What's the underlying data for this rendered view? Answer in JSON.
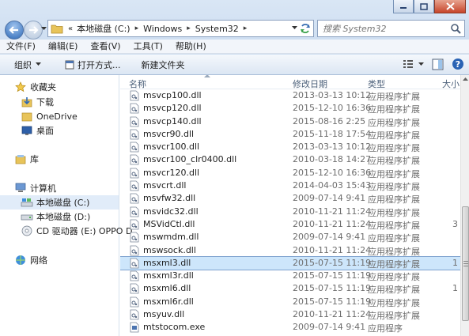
{
  "window": {
    "minimize_label": "",
    "colors": {
      "accent": "#2d69b6",
      "selection": "#cde6fb",
      "close": "#c7452b"
    }
  },
  "address": {
    "lead": "«",
    "crumbs": [
      "本地磁盘 (C:)",
      "Windows",
      "System32"
    ]
  },
  "search": {
    "placeholder": "搜索 System32"
  },
  "menubar": [
    "文件(F)",
    "编辑(E)",
    "查看(V)",
    "工具(T)",
    "帮助(H)"
  ],
  "toolbar": {
    "organize": "组织",
    "open_with": "打开方式...",
    "new_folder": "新建文件夹"
  },
  "nav": {
    "favorites": "收藏夹",
    "downloads": "下载",
    "onedrive": "OneDrive",
    "desktop": "桌面",
    "libraries": "库",
    "computer": "计算机",
    "drive_c": "本地磁盘 (C:)",
    "drive_d": "本地磁盘 (D:)",
    "cd_drive": "CD 驱动器 (E:) OPPO D",
    "network": "网络"
  },
  "columns": {
    "name": "名称",
    "date": "修改日期",
    "type": "类型",
    "size": "大小"
  },
  "files": [
    {
      "name": "msvcp100.dll",
      "date": "2013-03-13 10:12",
      "type": "应用程序扩展",
      "size": ""
    },
    {
      "name": "msvcp120.dll",
      "date": "2015-12-10 16:36",
      "type": "应用程序扩展",
      "size": ""
    },
    {
      "name": "msvcp140.dll",
      "date": "2015-08-16 2:25",
      "type": "应用程序扩展",
      "size": ""
    },
    {
      "name": "msvcr90.dll",
      "date": "2015-11-18 17:54",
      "type": "应用程序扩展",
      "size": ""
    },
    {
      "name": "msvcr100.dll",
      "date": "2013-03-13 10:12",
      "type": "应用程序扩展",
      "size": ""
    },
    {
      "name": "msvcr100_clr0400.dll",
      "date": "2010-03-18 14:27",
      "type": "应用程序扩展",
      "size": ""
    },
    {
      "name": "msvcr120.dll",
      "date": "2015-12-10 16:36",
      "type": "应用程序扩展",
      "size": ""
    },
    {
      "name": "msvcrt.dll",
      "date": "2014-04-03 15:43",
      "type": "应用程序扩展",
      "size": ""
    },
    {
      "name": "msvfw32.dll",
      "date": "2009-07-14 9:41",
      "type": "应用程序扩展",
      "size": ""
    },
    {
      "name": "msvidc32.dll",
      "date": "2010-11-21 11:24",
      "type": "应用程序扩展",
      "size": ""
    },
    {
      "name": "MSVidCtl.dll",
      "date": "2010-11-21 11:24",
      "type": "应用程序扩展",
      "size": "3"
    },
    {
      "name": "mswmdm.dll",
      "date": "2009-07-14 9:41",
      "type": "应用程序扩展",
      "size": ""
    },
    {
      "name": "mswsock.dll",
      "date": "2010-11-21 11:24",
      "type": "应用程序扩展",
      "size": ""
    },
    {
      "name": "msxml3.dll",
      "date": "2015-07-15 11:19",
      "type": "应用程序扩展",
      "size": "1",
      "selected": true
    },
    {
      "name": "msxml3r.dll",
      "date": "2015-07-15 11:19",
      "type": "应用程序扩展",
      "size": ""
    },
    {
      "name": "msxml6.dll",
      "date": "2015-07-15 11:19",
      "type": "应用程序扩展",
      "size": "1"
    },
    {
      "name": "msxml6r.dll",
      "date": "2015-07-15 11:19",
      "type": "应用程序扩展",
      "size": ""
    },
    {
      "name": "msyuv.dll",
      "date": "2010-11-21 11:24",
      "type": "应用程序扩展",
      "size": ""
    },
    {
      "name": "mtstocom.exe",
      "date": "2009-07-14 9:41",
      "type": "应用程序",
      "size": ""
    }
  ]
}
